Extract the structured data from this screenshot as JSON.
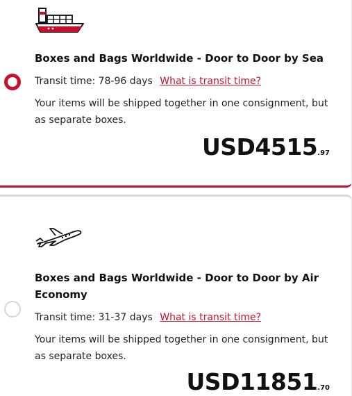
{
  "options": [
    {
      "icon": "cargo-ship-icon",
      "title": "Boxes and Bags Worldwide - Door to Door by Sea",
      "transit_text": "Transit time: 78-96 days",
      "transit_link": "What is transit time?",
      "description": "Your items will be shipped together in one consignment, but as separate boxes.",
      "price_main": "USD4515",
      "price_cents": ".97",
      "selected": true
    },
    {
      "icon": "airplane-icon",
      "title": "Boxes and Bags Worldwide - Door to Door by Air Economy",
      "transit_text": "Transit time: 31-37 days",
      "transit_link": "What is transit time?",
      "description": "Your items will be shipped together in one consignment, but as separate boxes.",
      "price_main": "USD11851",
      "price_cents": ".70",
      "selected": false
    }
  ],
  "colors": {
    "accent": "#c8102e",
    "text": "#111111",
    "radio_unselected": "#d6d6d6",
    "divider": "#d9d9d9"
  }
}
